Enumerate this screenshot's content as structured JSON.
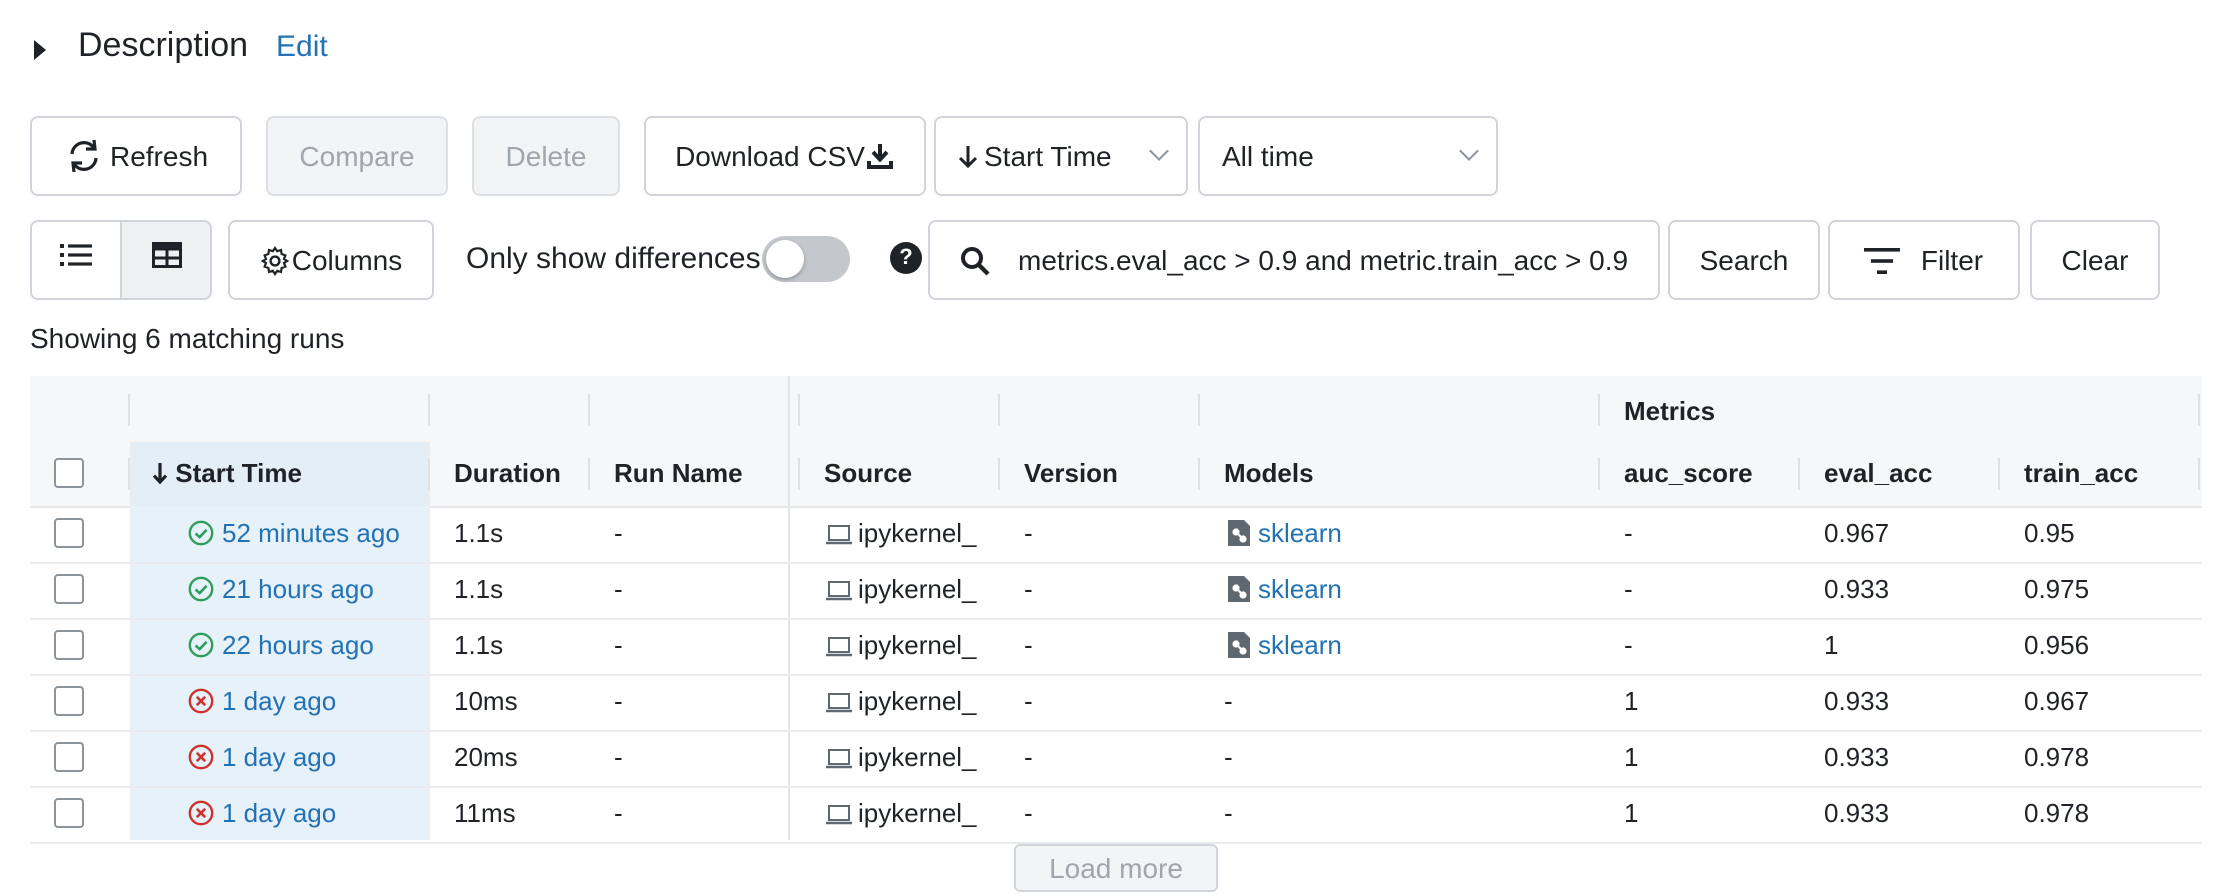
{
  "description": {
    "title": "Description",
    "edit_label": "Edit"
  },
  "toolbar": {
    "refresh_label": "Refresh",
    "compare_label": "Compare",
    "delete_label": "Delete",
    "download_label": "Download CSV",
    "sort_label": "Start Time",
    "time_range_label": "All time"
  },
  "toolbar2": {
    "columns_label": "Columns",
    "only_diff_label": "Only show differences",
    "only_diff_on": false,
    "search_value": "metrics.eval_acc > 0.9 and metric.train_acc > 0.9",
    "search_label": "Search",
    "filter_label": "Filter",
    "clear_label": "Clear"
  },
  "summary": "Showing 6 matching runs",
  "table": {
    "group_header": "Metrics",
    "columns": [
      "Start Time",
      "Duration",
      "Run Name",
      "Source",
      "Version",
      "Models",
      "auc_score",
      "eval_acc",
      "train_acc"
    ],
    "rows": [
      {
        "status": "success",
        "start": "52 minutes ago",
        "duration": "1.1s",
        "run_name": "-",
        "source": "ipykernel_",
        "version": "-",
        "model": "sklearn",
        "auc": "-",
        "eval": "0.967",
        "train": "0.95"
      },
      {
        "status": "success",
        "start": "21 hours ago",
        "duration": "1.1s",
        "run_name": "-",
        "source": "ipykernel_",
        "version": "-",
        "model": "sklearn",
        "auc": "-",
        "eval": "0.933",
        "train": "0.975"
      },
      {
        "status": "success",
        "start": "22 hours ago",
        "duration": "1.1s",
        "run_name": "-",
        "source": "ipykernel_",
        "version": "-",
        "model": "sklearn",
        "auc": "-",
        "eval": "1",
        "train": "0.956"
      },
      {
        "status": "failed",
        "start": "1 day ago",
        "duration": "10ms",
        "run_name": "-",
        "source": "ipykernel_",
        "version": "-",
        "model": "-",
        "auc": "1",
        "eval": "0.933",
        "train": "0.967"
      },
      {
        "status": "failed",
        "start": "1 day ago",
        "duration": "20ms",
        "run_name": "-",
        "source": "ipykernel_",
        "version": "-",
        "model": "-",
        "auc": "1",
        "eval": "0.933",
        "train": "0.978"
      },
      {
        "status": "failed",
        "start": "1 day ago",
        "duration": "11ms",
        "run_name": "-",
        "source": "ipykernel_",
        "version": "-",
        "model": "-",
        "auc": "1",
        "eval": "0.933",
        "train": "0.978"
      }
    ]
  },
  "load_more_label": "Load more",
  "colors": {
    "link": "#2272b4",
    "success": "#2e9e5b",
    "failed": "#d0312d",
    "sorted_column": "#e6f1fa"
  }
}
